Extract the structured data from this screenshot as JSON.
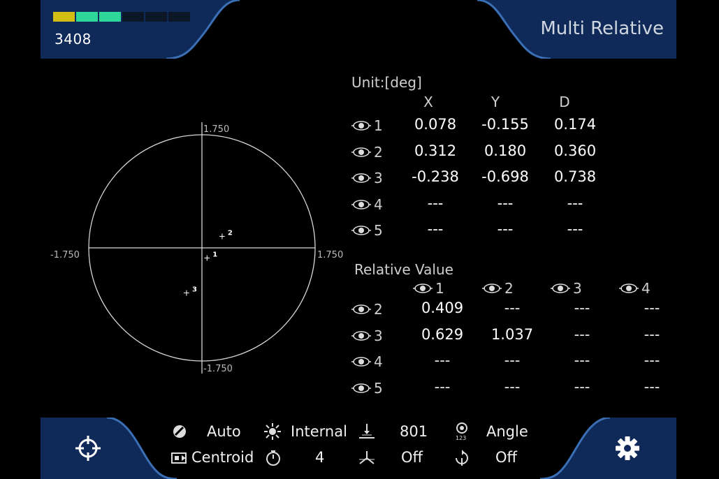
{
  "header": {
    "level_value": "3408",
    "meter": [
      "#d2bd14",
      "#2fd69a",
      "#2fd69a",
      "#0b1626",
      "#0b1626",
      "#0b1626"
    ],
    "mode_title": "Multi Relative"
  },
  "plot": {
    "pos_y_label": "1.750",
    "neg_y_label": "-1.750",
    "pos_x_label": "1.750",
    "neg_x_label": "-1.750",
    "points": [
      {
        "label": "1",
        "x": 0.078,
        "y": -0.155
      },
      {
        "label": "2",
        "x": 0.312,
        "y": 0.18
      },
      {
        "label": "3",
        "x": -0.238,
        "y": -0.698
      }
    ]
  },
  "measure": {
    "unit_label": "Unit:[deg]",
    "columns": [
      "X",
      "Y",
      "D"
    ],
    "rows": [
      {
        "id": "1",
        "x": "0.078",
        "y": "-0.155",
        "d": "0.174"
      },
      {
        "id": "2",
        "x": "0.312",
        "y": "0.180",
        "d": "0.360"
      },
      {
        "id": "3",
        "x": "-0.238",
        "y": "-0.698",
        "d": "0.738"
      },
      {
        "id": "4",
        "x": "---",
        "y": "---",
        "d": "---"
      },
      {
        "id": "5",
        "x": "---",
        "y": "---",
        "d": "---"
      }
    ]
  },
  "relative": {
    "title": "Relative Value",
    "columns": [
      "1",
      "2",
      "3",
      "4"
    ],
    "rows": [
      {
        "id": "2",
        "values": [
          "0.409",
          "---",
          "---",
          "---"
        ]
      },
      {
        "id": "3",
        "values": [
          "0.629",
          "1.037",
          "---",
          "---"
        ]
      },
      {
        "id": "4",
        "values": [
          "---",
          "---",
          "---",
          "---"
        ]
      },
      {
        "id": "5",
        "values": [
          "---",
          "---",
          "---",
          "---"
        ]
      }
    ]
  },
  "status": {
    "exposure": "Auto",
    "light": "Internal",
    "gain": "801",
    "display": "Angle",
    "detection": "Centroid",
    "timer": "4",
    "filter": "Off",
    "rotate": "Off"
  },
  "icons": {
    "crosshair": "crosshair-icon",
    "settings": "gear-icon"
  }
}
